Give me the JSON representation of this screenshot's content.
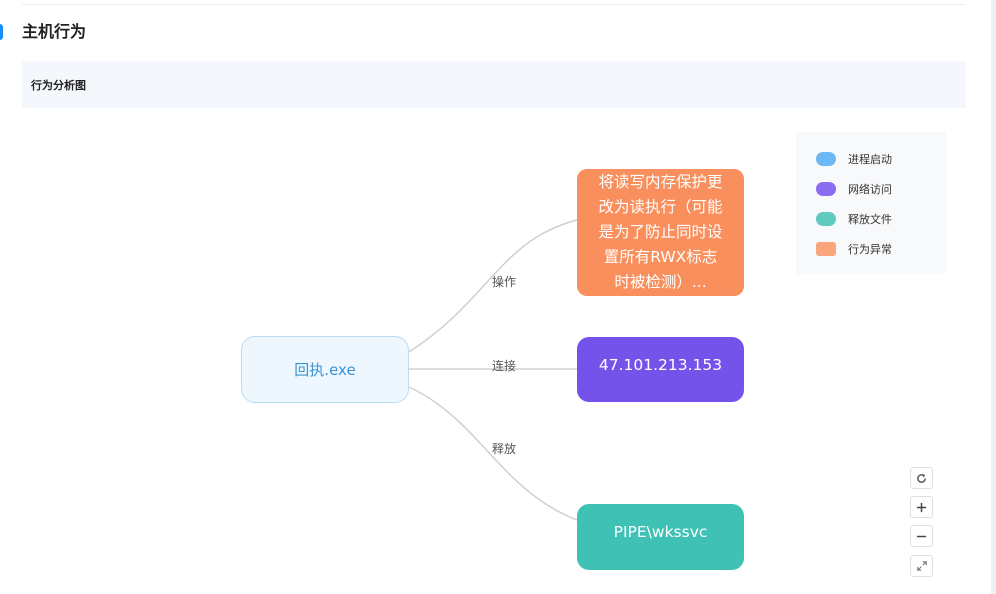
{
  "section": {
    "title": "主机行为"
  },
  "panel": {
    "title": "行为分析图"
  },
  "graph": {
    "root": {
      "label": "回执.exe"
    },
    "edges": [
      {
        "label": "操作"
      },
      {
        "label": "连接"
      },
      {
        "label": "释放"
      }
    ],
    "nodes": {
      "operation": {
        "lines": [
          "将读写内存保护更",
          "改为读执行（可能",
          "是为了防止同时设",
          "置所有RWX标志",
          "时被检测）..."
        ]
      },
      "network": {
        "label": "47.101.213.153"
      },
      "file": {
        "label": "PIPE\\wkssvc"
      }
    }
  },
  "legend": {
    "items": [
      {
        "label": "进程启动",
        "color": "#6bb8f5"
      },
      {
        "label": "网络访问",
        "color": "#8a6cf0"
      },
      {
        "label": "释放文件",
        "color": "#5fcac0"
      },
      {
        "label": "行为异常",
        "color": "#f9a57d"
      }
    ]
  },
  "controls": {
    "refresh_icon": "refresh-icon",
    "zoom_in_icon": "plus-icon",
    "zoom_out_icon": "minus-icon",
    "fullscreen_icon": "expand-icon"
  }
}
